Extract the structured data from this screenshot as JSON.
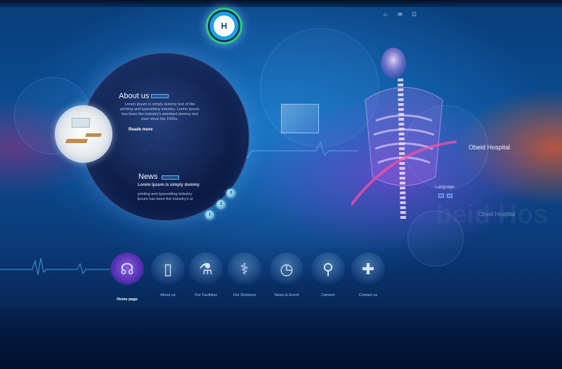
{
  "header": {
    "logo_letter": "H",
    "top_icons": [
      "home-icon",
      "mail-icon",
      "sitemap-icon"
    ]
  },
  "about": {
    "title": "About us",
    "text": "Lorem Ipsum is simply dummy text of the printing and typesetting industry. Lorem Ipsum has been the industry's standard dummy text ever since the 1500s,",
    "read_more": "Reade more"
  },
  "news": {
    "title": "News",
    "headline": "Lorem Ipsum is simply dummy",
    "text": "printing and typesetting industry. Ipsum has been the industry's st",
    "pages": [
      "1",
      "2",
      "3"
    ]
  },
  "brand": {
    "name": "Obeid Hospital",
    "ghost_name": "Obeid Hospital",
    "big_ghost": "beid Hos",
    "language_label": "Language"
  },
  "nav": [
    {
      "label": "Home page",
      "icon": "stethoscope-icon",
      "active": true
    },
    {
      "label": "About us",
      "icon": "door-icon",
      "active": false
    },
    {
      "label": "Our Facilities",
      "icon": "microscope-icon",
      "active": false
    },
    {
      "label": "Our Divisions",
      "icon": "caduceus-icon",
      "active": false
    },
    {
      "label": "News & Event",
      "icon": "clock-icon",
      "active": false
    },
    {
      "label": "Careers",
      "icon": "test-tubes-icon",
      "active": false
    },
    {
      "label": "Contact us",
      "icon": "first-aid-kit-icon",
      "active": false
    }
  ],
  "colors": {
    "accent": "#5ab8ff",
    "active_nav": "#7a4ad6",
    "background": "#0b4f96"
  }
}
